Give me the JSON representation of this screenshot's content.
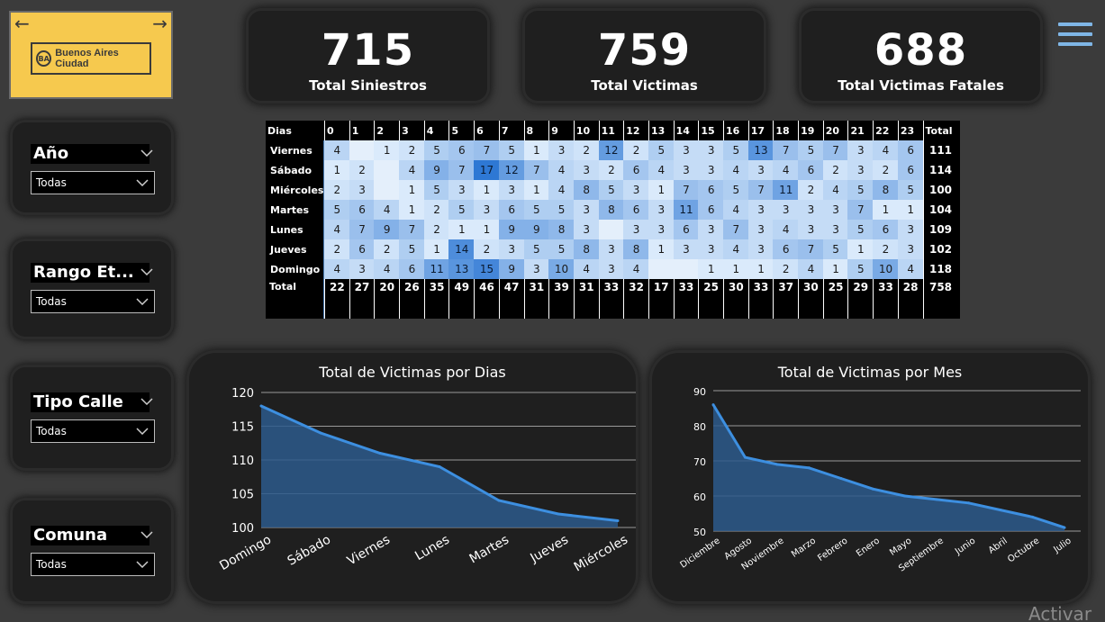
{
  "logo": {
    "text": "Buenos Aires Ciudad"
  },
  "kpis": [
    {
      "value": "715",
      "label": "Total Siniestros"
    },
    {
      "value": "759",
      "label": "Total Victimas"
    },
    {
      "value": "688",
      "label": "Total Victimas Fatales"
    }
  ],
  "slicers": [
    {
      "title": "Año",
      "value": "Todas"
    },
    {
      "title": "Rango Et...",
      "value": "Todas"
    },
    {
      "title": "Tipo Calle",
      "value": "Todas"
    },
    {
      "title": "Comuna",
      "value": "Todas"
    }
  ],
  "matrix": {
    "corner": "Dias",
    "hours": [
      "0",
      "1",
      "2",
      "3",
      "4",
      "5",
      "6",
      "7",
      "8",
      "9",
      "10",
      "11",
      "12",
      "13",
      "14",
      "15",
      "16",
      "17",
      "18",
      "19",
      "20",
      "21",
      "22",
      "23"
    ],
    "total_label": "Total",
    "rows": [
      {
        "day": "Viernes",
        "values": [
          4,
          "",
          1,
          2,
          5,
          6,
          7,
          5,
          1,
          3,
          2,
          12,
          2,
          5,
          3,
          3,
          5,
          13,
          7,
          5,
          7,
          3,
          4,
          6
        ],
        "total": "111"
      },
      {
        "day": "Sábado",
        "values": [
          1,
          2,
          "",
          4,
          9,
          7,
          17,
          12,
          7,
          4,
          3,
          2,
          6,
          4,
          3,
          3,
          4,
          3,
          4,
          6,
          2,
          3,
          2,
          6
        ],
        "total": "114"
      },
      {
        "day": "Miércoles",
        "values": [
          2,
          3,
          "",
          1,
          5,
          3,
          1,
          3,
          1,
          4,
          8,
          5,
          3,
          1,
          7,
          6,
          5,
          7,
          11,
          2,
          4,
          5,
          8,
          5
        ],
        "total": "100"
      },
      {
        "day": "Martes",
        "values": [
          5,
          6,
          4,
          1,
          2,
          5,
          3,
          6,
          5,
          5,
          3,
          8,
          6,
          3,
          11,
          6,
          4,
          3,
          3,
          3,
          3,
          7,
          1,
          1
        ],
        "total": "104"
      },
      {
        "day": "Lunes",
        "values": [
          4,
          7,
          9,
          7,
          2,
          1,
          1,
          9,
          9,
          8,
          3,
          "",
          3,
          3,
          6,
          3,
          7,
          3,
          4,
          3,
          3,
          5,
          6,
          3
        ],
        "total": "109"
      },
      {
        "day": "Jueves",
        "values": [
          2,
          6,
          2,
          5,
          1,
          14,
          2,
          3,
          5,
          5,
          8,
          3,
          8,
          1,
          3,
          3,
          4,
          3,
          6,
          7,
          5,
          1,
          2,
          3
        ],
        "total": "102"
      },
      {
        "day": "Domingo",
        "values": [
          4,
          3,
          4,
          6,
          11,
          13,
          15,
          9,
          3,
          10,
          4,
          3,
          4,
          "",
          "",
          1,
          1,
          1,
          2,
          4,
          1,
          5,
          10,
          4
        ],
        "total": "118"
      }
    ],
    "totals": [
      "22",
      "27",
      "20",
      "26",
      "35",
      "49",
      "46",
      "47",
      "31",
      "39",
      "31",
      "33",
      "32",
      "17",
      "33",
      "25",
      "30",
      "33",
      "37",
      "30",
      "25",
      "29",
      "33",
      "28"
    ],
    "grand_total": "758"
  },
  "chart_data": [
    {
      "type": "area",
      "title": "Total de Victimas por Dias",
      "categories": [
        "Domingo",
        "Sábado",
        "Viernes",
        "Lunes",
        "Martes",
        "Jueves",
        "Miércoles"
      ],
      "values": [
        118,
        114,
        111,
        109,
        104,
        102,
        101
      ],
      "ylim": [
        100,
        120
      ],
      "yticks": [
        "100",
        "105",
        "110",
        "115",
        "120"
      ],
      "color": "#3d8fe0"
    },
    {
      "type": "area",
      "title": "Total de Victimas por Mes",
      "categories": [
        "Diciembre",
        "Agosto",
        "Noviembre",
        "Marzo",
        "Febrero",
        "Enero",
        "Mayo",
        "Septiembre",
        "Junio",
        "Abril",
        "Octubre",
        "Julio"
      ],
      "values": [
        86,
        71,
        69,
        68,
        65,
        62,
        60,
        59,
        58,
        56,
        54,
        51
      ],
      "ylim": [
        50,
        90
      ],
      "yticks": [
        "50",
        "60",
        "70",
        "80",
        "90"
      ],
      "color": "#3d8fe0"
    }
  ],
  "watermark": "Activar"
}
